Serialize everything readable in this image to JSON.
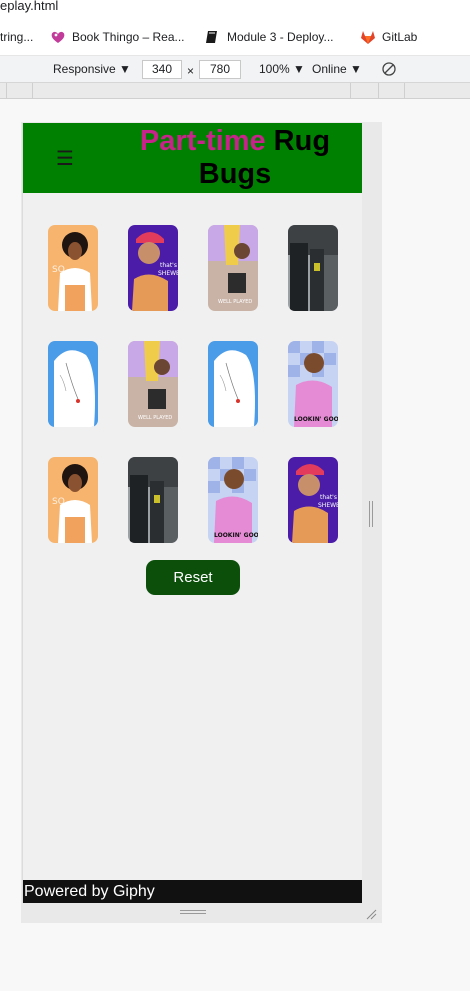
{
  "browser": {
    "url_fragment": "eplay.html",
    "bookmarks": [
      {
        "label": "tring..."
      },
      {
        "label": "Book Thingo – Rea..."
      },
      {
        "label": "Module 3 - Deploy..."
      },
      {
        "label": "GitLab"
      }
    ]
  },
  "devtools": {
    "device": "Responsive",
    "width": "340",
    "times": "×",
    "height": "780",
    "zoom": "100%",
    "network": "Online"
  },
  "app": {
    "menu_icon": "☰",
    "title_accent": "Part-time",
    "title_rest": " Rug Bugs",
    "cards": [
      {
        "image": "woman-with-afro-orange"
      },
      {
        "image": "shewbiz-girl-purple"
      },
      {
        "image": "well-played-lilac"
      },
      {
        "image": "street-crowd-photo"
      },
      {
        "image": "line-drawing-blue"
      },
      {
        "image": "well-played-lilac"
      },
      {
        "image": "line-drawing-blue"
      },
      {
        "image": "lookin-good-checker"
      },
      {
        "image": "woman-with-afro-orange"
      },
      {
        "image": "street-crowd-photo"
      },
      {
        "image": "lookin-good-checker"
      },
      {
        "image": "shewbiz-girl-purple"
      }
    ],
    "reset_label": "Reset",
    "footer_text": "Powered by Giphy"
  }
}
